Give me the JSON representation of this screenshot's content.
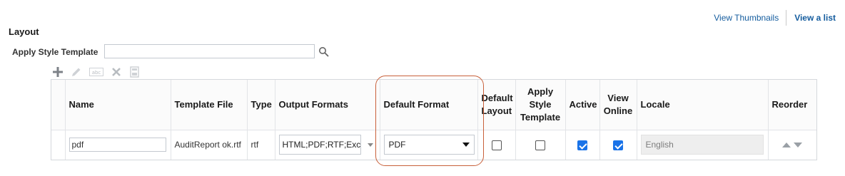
{
  "nav": {
    "view_thumbnails": "View Thumbnails",
    "view_list": "View a list"
  },
  "layout": {
    "title": "Layout",
    "apply_style_template_label": "Apply Style Template",
    "apply_style_template_value": ""
  },
  "toolbar": {
    "icons": [
      "add-icon",
      "edit-icon",
      "rename-icon",
      "delete-icon",
      "save-icon"
    ]
  },
  "table": {
    "headers": {
      "name": "Name",
      "template_file": "Template File",
      "type": "Type",
      "output_formats": "Output Formats",
      "default_format": "Default Format",
      "default_layout": "Default Layout",
      "apply_style_template": "Apply Style Template",
      "active": "Active",
      "view_online": "View Online",
      "locale": "Locale",
      "reorder": "Reorder"
    },
    "rows": [
      {
        "name": "pdf",
        "template_file": "AuditReport ok.rtf",
        "type": "rtf",
        "output_formats": "HTML;PDF;RTF;Excel",
        "default_format": "PDF",
        "default_layout": false,
        "apply_style_template": false,
        "active": true,
        "view_online": true,
        "locale": "English"
      }
    ]
  },
  "colors": {
    "link": "#145c9e",
    "highlight": "#c8603a",
    "checkbox_on": "#1a73e8"
  }
}
